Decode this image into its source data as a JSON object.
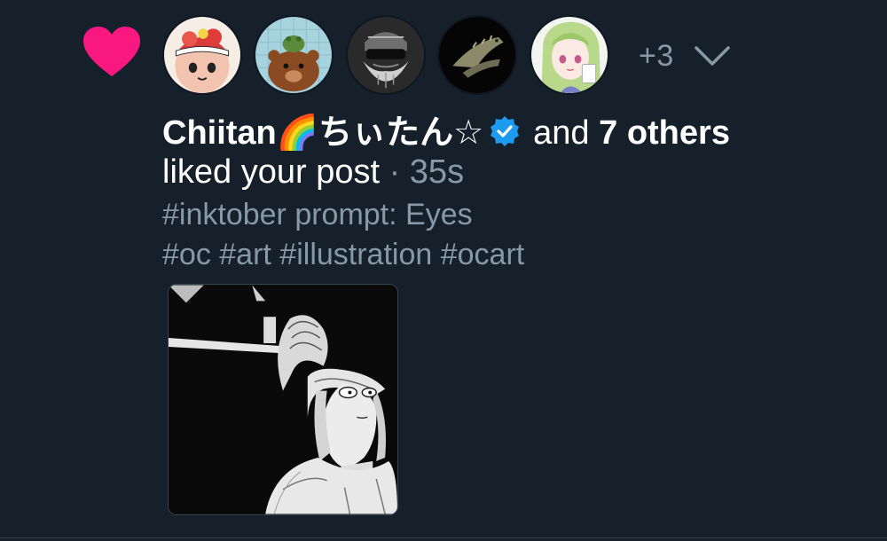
{
  "notification": {
    "type_icon": "heart-icon",
    "type_color": "#f91880",
    "avatars": [
      {
        "icon": "cat-avatar"
      },
      {
        "icon": "otter-frog-avatar"
      },
      {
        "icon": "bearded-man-avatar"
      },
      {
        "icon": "fish-avatar"
      },
      {
        "icon": "anime-girl-avatar"
      }
    ],
    "overflow_count": "+3",
    "actor_name": "Chiitan🌈ちぃたん☆",
    "verified": true,
    "verified_color": "#1d9bf0",
    "and_text": "and",
    "others_text": "7 others",
    "action_text": "liked your post",
    "separator": "·",
    "time": "35s"
  },
  "post": {
    "line1": "#inktober prompt: Eyes",
    "line2": "#oc #art #illustration #ocart",
    "image": {
      "icon": "manga-illustration-thumbnail"
    }
  },
  "colors": {
    "background": "#15202b",
    "secondary_text": "#8899a6",
    "primary_text": "#ffffff"
  }
}
